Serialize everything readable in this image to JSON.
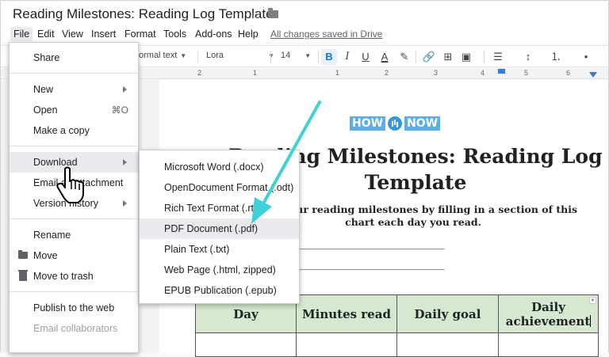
{
  "title": "Reading Milestones: Reading Log Template",
  "menu": {
    "items": [
      "File",
      "Edit",
      "View",
      "Insert",
      "Format",
      "Tools",
      "Add-ons",
      "Help"
    ],
    "active": "File",
    "saved": "All changes saved in Drive"
  },
  "toolbar": {
    "style": "ormal text",
    "font": "Lora",
    "size": "14",
    "bold": "B",
    "italic": "I",
    "underline": "U",
    "text_color": "A"
  },
  "ruler": {
    "marks": [
      "2",
      "1",
      "1",
      "2",
      "3",
      "4",
      "5",
      "6"
    ]
  },
  "file_menu": {
    "share": "Share",
    "new": "New",
    "open": "Open",
    "open_shortcut": "⌘O",
    "make_copy": "Make a copy",
    "download": "Download",
    "email_attachment": "Email as attachment",
    "version_history": "Version history",
    "rename": "Rename",
    "move": "Move",
    "move_to_trash": "Move to trash",
    "publish": "Publish to the web",
    "email_collaborators": "Email collaborators"
  },
  "download_menu": {
    "items": [
      "Microsoft Word (.docx)",
      "OpenDocument Format (.odt)",
      "Rich Text Format (.rtf)",
      "PDF Document (.pdf)",
      "Plain Text (.txt)",
      "Web Page (.html, zipped)",
      "EPUB Publication (.epub)"
    ],
    "highlighted": "PDF Document (.pdf)"
  },
  "document": {
    "logo_left": "HOW",
    "logo_right": "NOW",
    "heading_line1": "Reading Milestones: Reading Log",
    "heading_line2": "Template",
    "subtitle": "Track your reading milestones by filling in a section of this chart each day you read.",
    "dash_line1": "_________________________",
    "dash_line2": "_________________________",
    "table_headers": [
      "Day",
      "Minutes read",
      "Daily goal",
      "Daily achievement"
    ]
  },
  "colors": {
    "accent_arrow": "#3fd0d8",
    "table_header_bg": "#d6e8cf",
    "link_blue": "#1a73e8",
    "logo_blue": "#5dade2"
  }
}
